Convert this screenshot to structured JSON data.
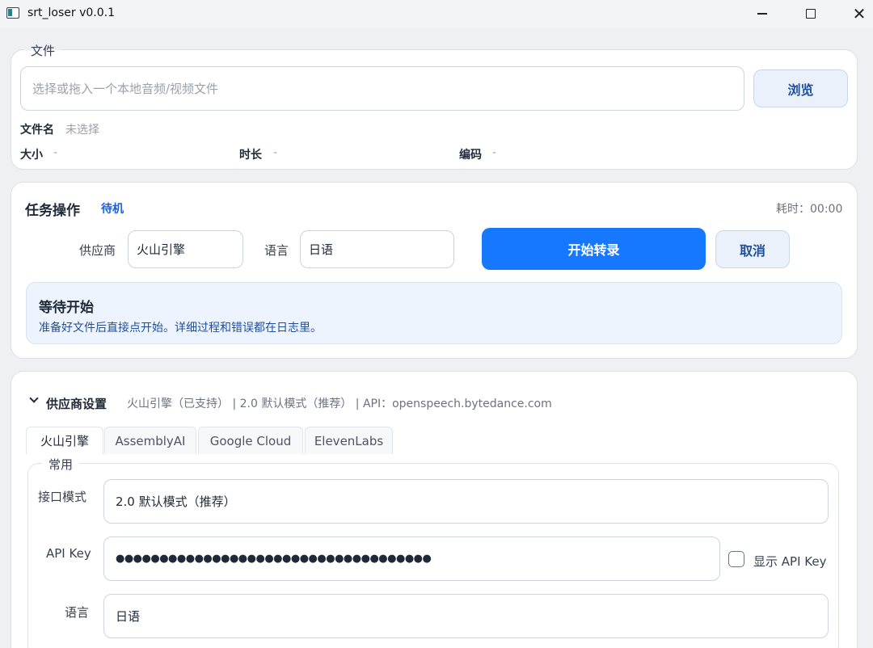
{
  "window": {
    "title": "srt_loser v0.0.1"
  },
  "file_section": {
    "legend": "文件",
    "input_placeholder": "选择或拖入一个本地音频/视频文件",
    "browse_label": "浏览",
    "filename_label": "文件名",
    "filename_value": "未选择",
    "size_label": "大小",
    "size_value": "-",
    "duration_label": "时长",
    "duration_value": "-",
    "codec_label": "编码",
    "codec_value": "-"
  },
  "task_section": {
    "title": "任务操作",
    "status": "待机",
    "elapsed": "耗时：00:00",
    "provider_label": "供应商",
    "provider_value": "火山引擎",
    "language_label": "语言",
    "language_value": "日语",
    "start_label": "开始转录",
    "cancel_label": "取消",
    "status_title": "等待开始",
    "status_desc": "准备好文件后直接点开始。详细过程和错误都在日志里。"
  },
  "provider_settings": {
    "title": "供应商设置",
    "summary": "火山引擎（已支持） | 2.0 默认模式（推荐） | API：openspeech.bytedance.com",
    "tabs": [
      "火山引擎",
      "AssemblyAI",
      "Google Cloud",
      "ElevenLabs"
    ],
    "group_legend": "常用",
    "mode_label": "接口模式",
    "mode_value": "2.0 默认模式（推荐）",
    "apikey_label": "API Key",
    "apikey_value": "●●●●●●●●●●●●●●●●●●●●●●●●●●●●●●●●●●●●",
    "show_apikey_label": "显示 API Key",
    "lang_label": "语言",
    "lang_value": "日语"
  },
  "colors": {
    "accent": "#1677ff",
    "status_text": "#1f4f9c"
  }
}
